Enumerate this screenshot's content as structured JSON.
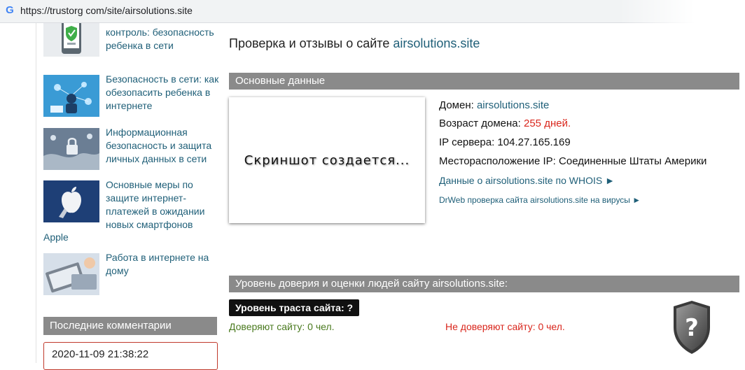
{
  "browser": {
    "url": "https://trustorg com/site/airsolutions.site",
    "icon": "google-g-icon"
  },
  "sidebar": {
    "articles": [
      {
        "title": "контроль: безопасность ребенка в сети"
      },
      {
        "title": "Безопасность в сети: как обезопасить ребенка в интернете"
      },
      {
        "title": "Информационная безопасность и защита личных данных в сети"
      },
      {
        "title": "Основные меры по защите интернет-платежей в ожидании новых смартфонов"
      },
      {
        "title": "Работа в интернете на дому"
      }
    ],
    "apple_tail": "Apple",
    "comments_header": "Последние комментарии",
    "comment_date": "2020-11-09 21:38:22"
  },
  "main": {
    "title_prefix": "Проверка и отзывы о сайте",
    "title_site": "airsolutions.site",
    "basic_header": "Основные данные",
    "screenshot_caption": "Скриншот создается...",
    "domain_label": "Домен:",
    "domain_value": "airsolutions.site",
    "age_label": "Возраст домена:",
    "age_value": "255 дней.",
    "ip_label": "IP сервера:",
    "ip_value": "104.27.165.169",
    "location_label": "Месторасположение IP:",
    "location_value": "Соединенные Штаты Америки",
    "whois_link": "Данные о airsolutions.site по WHOIS ►",
    "drweb_link": "DrWeb проверка сайта airsolutions.site на вирусы ►",
    "trust_header": "Уровень доверия и оценки людей сайту airsolutions.site:",
    "trust_level": "Уровень траста сайта: ?",
    "trust_yes": "Доверяют сайту: 0 чел.",
    "trust_no": "Не доверяют сайту: 0 чел.",
    "shield_mark": "?",
    "shield_icon": "question-shield-icon"
  },
  "colors": {
    "link": "#1f5f78",
    "header_bar": "#8a8a8a",
    "red": "#d9261c",
    "green": "#4a7a1f"
  }
}
